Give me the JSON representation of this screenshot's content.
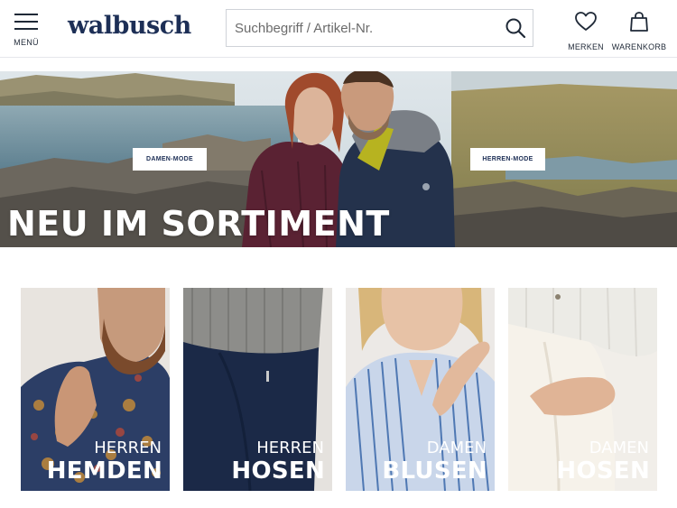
{
  "header": {
    "menu_label": "MENÜ",
    "logo_text": "walbusch",
    "search_placeholder": "Suchbegriff / Artikel-Nr.",
    "merken_label": "MERKEN",
    "warenkorb_label": "WARENKORB",
    "icons": {
      "menu": "hamburger-icon",
      "search": "magnifier-icon",
      "merken": "heart-icon",
      "warenkorb": "shopping-bag-icon"
    }
  },
  "hero": {
    "damen_button": "DAMEN-MODE",
    "herren_button": "HERREN-MODE",
    "headline": "NEU IM SORTIMENT"
  },
  "categories": [
    {
      "line1": "HERREN",
      "line2": "HEMDEN"
    },
    {
      "line1": "HERREN",
      "line2": "HOSEN"
    },
    {
      "line1": "DAMEN",
      "line2": "BLUSEN"
    },
    {
      "line1": "DAMEN",
      "line2": "HOSEN"
    }
  ],
  "colors": {
    "brand_navy": "#1d2f56",
    "text_dark": "#1f2937",
    "border": "#cfd3d8"
  }
}
